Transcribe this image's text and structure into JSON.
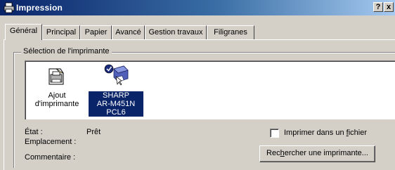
{
  "window": {
    "title": "Impression",
    "help_label": "?",
    "close_label": "x"
  },
  "tabs": [
    {
      "label": "Général",
      "active": true
    },
    {
      "label": "Principal"
    },
    {
      "label": "Papier"
    },
    {
      "label": "Avancé"
    },
    {
      "label": "Gestion travaux"
    },
    {
      "label": "Filigranes"
    }
  ],
  "printer_selection": {
    "title": "Sélection de l'imprimante",
    "items": [
      {
        "label_line1": "Ajout",
        "label_line2": "d'imprimante",
        "icon": "add-printer-icon"
      },
      {
        "label_line1": "SHARP",
        "label_line2": "AR-M451N PCL6",
        "icon": "network-printer-icon",
        "selected": true,
        "default": true
      }
    ]
  },
  "status": {
    "state_label": "État :",
    "state_value": "Prêt",
    "location_label": "Emplacement :",
    "location_value": "",
    "comment_label": "Commentaire :",
    "comment_value": ""
  },
  "print_to_file": {
    "label_prefix": "Imprimer dans un ",
    "label_accel": "f",
    "label_suffix": "ichier",
    "checked": false
  },
  "find_printer_button": {
    "prefix": "Rec",
    "accel": "h",
    "suffix": "ercher une imprimante..."
  },
  "colors": {
    "titlebar_start": "#0a246a",
    "titlebar_end": "#a6caf0",
    "face": "#d4d0c8",
    "selection": "#0a246a"
  }
}
